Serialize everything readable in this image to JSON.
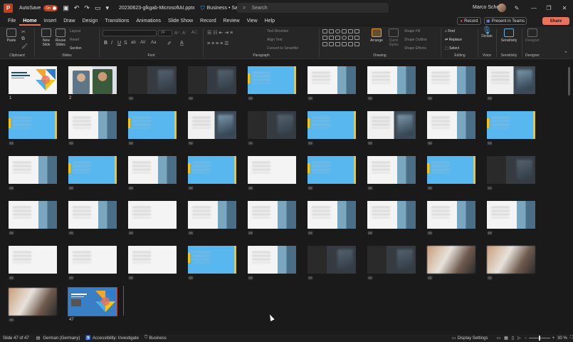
{
  "titlebar": {
    "logo": "P",
    "autosave_label": "AutoSave",
    "autosave_state": "On",
    "filename": "20230623-glkgab-MicrosoftAI.pptx",
    "save_status": "Business • Saved",
    "search_placeholder": "Search",
    "user_name": "Marco Scheel"
  },
  "tabs": [
    "File",
    "Home",
    "Insert",
    "Draw",
    "Design",
    "Transitions",
    "Animations",
    "Slide Show",
    "Record",
    "Review",
    "View",
    "Help"
  ],
  "active_tab": "Home",
  "header_buttons": {
    "record": "Record",
    "teams": "Present in Teams",
    "share": "Share"
  },
  "ribbon": {
    "clipboard": {
      "label": "Clipboard",
      "paste": "Paste"
    },
    "slides": {
      "label": "Slides",
      "new_slide": "New Slide",
      "reuse": "Reuse Slides",
      "layout": "Layout",
      "reset": "Reset",
      "section": "Section"
    },
    "font": {
      "label": "Font",
      "size": "24",
      "bold": "B",
      "italic": "I",
      "underline": "U",
      "strike": "S"
    },
    "paragraph": {
      "label": "Paragraph",
      "text_direction": "Text Direction",
      "align_text": "Align Text",
      "smartart": "Convert to SmartArt"
    },
    "drawing": {
      "label": "Drawing",
      "arrange": "Arrange",
      "quick_styles": "Quick Styles",
      "shape_fill": "Shape Fill",
      "shape_outline": "Shape Outline",
      "shape_effects": "Shape Effects"
    },
    "editing": {
      "label": "Editing",
      "find": "Find",
      "replace": "Replace",
      "select": "Select"
    },
    "voice": {
      "label": "Voice",
      "dictate": "Dictate"
    },
    "sensitivity": {
      "label": "Sensitivity",
      "btn": "Sensitivity"
    },
    "designer": {
      "label": "Designer",
      "btn": "Designer"
    }
  },
  "slides": {
    "visible_numbers": {
      "1": "1",
      "2": "2",
      "47": "47"
    },
    "types": [
      "title",
      "photo2",
      "dim",
      "dim",
      "blue",
      "mixed",
      "mixed",
      "mixed",
      "dark",
      "blue",
      "mixed",
      "blue",
      "dark",
      "dim",
      "blue",
      "dark",
      "mixed",
      "blue",
      "mixed",
      "blue",
      "mixed",
      "blue",
      "white",
      "blue",
      "mixed",
      "blue",
      "dim",
      "mixed",
      "mixed",
      "white",
      "mixed",
      "mixed",
      "mixed",
      "mixed",
      "mixed",
      "mixed",
      "white",
      "white",
      "white",
      "blue",
      "mixed",
      "dim",
      "dim",
      "photo",
      "photo",
      "photo",
      "title"
    ],
    "selected": 47
  },
  "status": {
    "slide_info": "Slide 47 of 47",
    "language": "German (Germany)",
    "accessibility": "Accessibility: Investigate",
    "label": "Business",
    "display_settings": "Display Settings",
    "zoom": "30 %"
  }
}
